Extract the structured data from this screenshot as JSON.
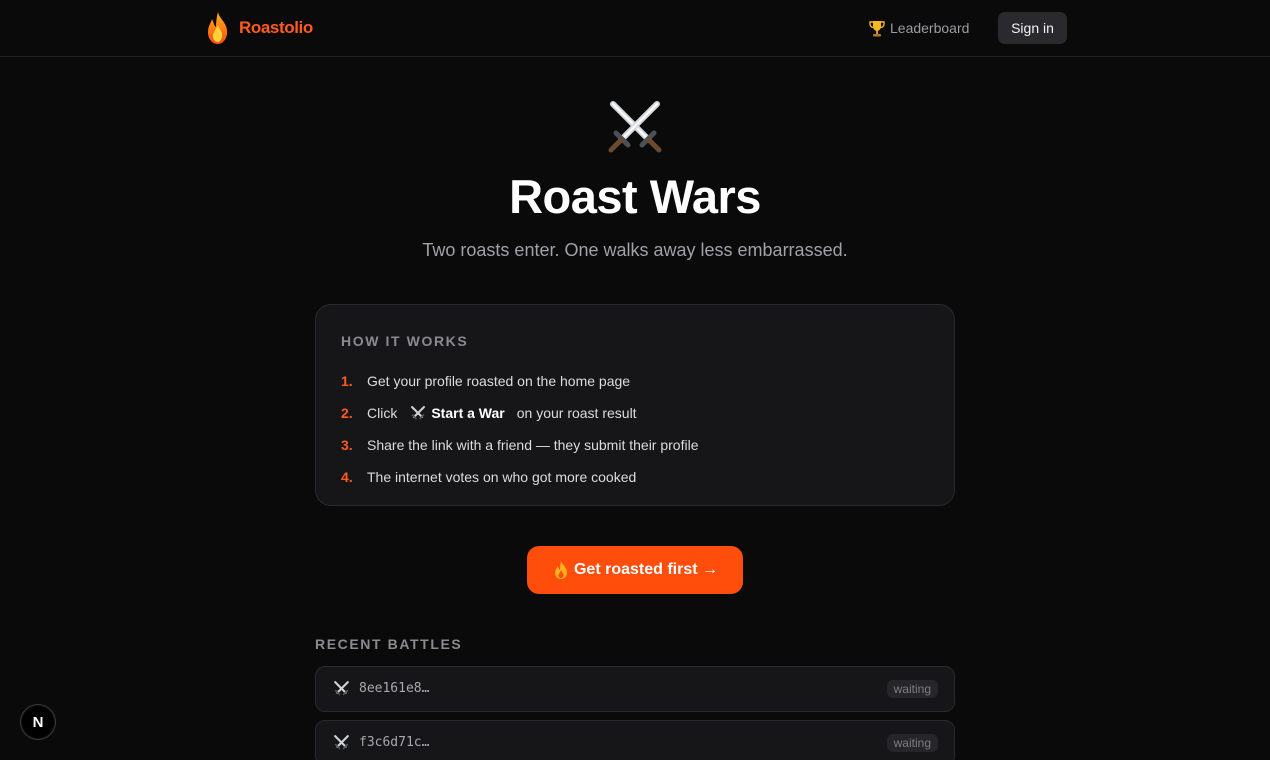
{
  "header": {
    "brand": "Roastolio",
    "nav_leaderboard": "Leaderboard",
    "signin_label": "Sign in"
  },
  "hero": {
    "title": "Roast Wars",
    "subtitle": "Two roasts enter. One walks away less embarrassed."
  },
  "how_it_works": {
    "heading": "HOW IT WORKS",
    "steps": [
      {
        "num": "1.",
        "text": "Get your profile roasted on the home page"
      },
      {
        "num": "2.",
        "pre": "Click",
        "action": "Start a War",
        "post": "on your roast result"
      },
      {
        "num": "3.",
        "text": "Share the link with a friend — they submit their profile"
      },
      {
        "num": "4.",
        "text": "The internet votes on who got more cooked"
      }
    ]
  },
  "cta": {
    "label": "Get roasted first →"
  },
  "recent": {
    "heading": "RECENT BATTLES",
    "battles": [
      {
        "id": "8ee161e8…",
        "status": "waiting"
      },
      {
        "id": "f3c6d71c…",
        "status": "waiting"
      }
    ]
  },
  "dev_badge": {
    "label": "N"
  },
  "colors": {
    "accent": "#ff4d0c",
    "background": "#0a0a0b",
    "card": "#161618"
  },
  "icons": {
    "logo": "flame-icon",
    "leaderboard": "trophy-icon",
    "hero": "crossed-swords-icon",
    "cta": "fire-icon"
  }
}
